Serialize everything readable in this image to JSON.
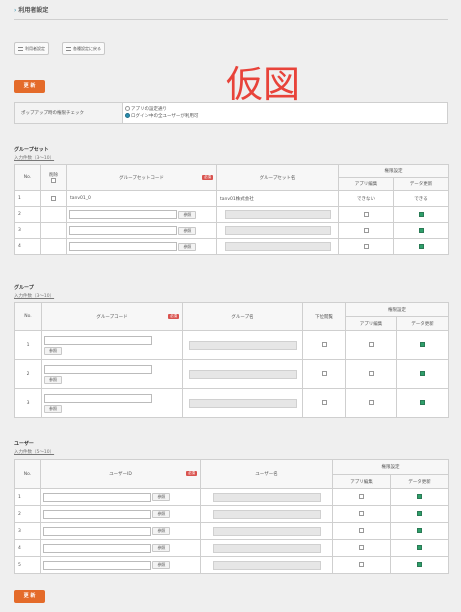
{
  "header": {
    "title": "利用者設定"
  },
  "toolbar": {
    "btn1": "利用者設定",
    "btn2": "各種設定に戻る"
  },
  "update_label": "更 新",
  "placeholder_image_text": "仮図",
  "popup": {
    "label": "ポップアップ時の権限チェック",
    "option1": "アプリの設定通り",
    "option2": "ログイン中の全ユーザーが利用可",
    "selected": 2
  },
  "groupset": {
    "title": "グループセット",
    "count": "入力件数（3〜10）",
    "headers": {
      "no": "No.",
      "delete": "削除",
      "code": "グループセットコード",
      "name": "グループセット名",
      "perm": "権限設定",
      "app": "アプリ編集",
      "data": "データ更新",
      "must": "必須"
    },
    "rows": [
      {
        "no": "1",
        "code": "tanv01_0",
        "name": "tanv01株式会社",
        "app": "できない",
        "data": "できる"
      },
      {
        "no": "2",
        "ref": "参照"
      },
      {
        "no": "3",
        "ref": "参照"
      },
      {
        "no": "4",
        "ref": "参照"
      }
    ]
  },
  "group": {
    "title": "グループ",
    "count": "入力件数（3〜10）",
    "headers": {
      "no": "No.",
      "code": "グループコード",
      "name": "グループ名",
      "lower": "下位閲覧",
      "perm": "権限設定",
      "app": "アプリ編集",
      "data": "データ更新",
      "must": "必須"
    },
    "rows": [
      {
        "no": "1",
        "ref": "参照"
      },
      {
        "no": "2",
        "ref": "参照"
      },
      {
        "no": "3",
        "ref": "参照"
      }
    ]
  },
  "user": {
    "title": "ユーザー",
    "count": "入力件数（5〜10）",
    "headers": {
      "no": "No.",
      "id": "ユーザーID",
      "name": "ユーザー名",
      "perm": "権限設定",
      "app": "アプリ編集",
      "data": "データ更新",
      "must": "必須"
    },
    "rows": [
      {
        "no": "1",
        "ref": "参照"
      },
      {
        "no": "2",
        "ref": "参照"
      },
      {
        "no": "3",
        "ref": "参照"
      },
      {
        "no": "4",
        "ref": "参照"
      },
      {
        "no": "5",
        "ref": "参照"
      }
    ]
  }
}
